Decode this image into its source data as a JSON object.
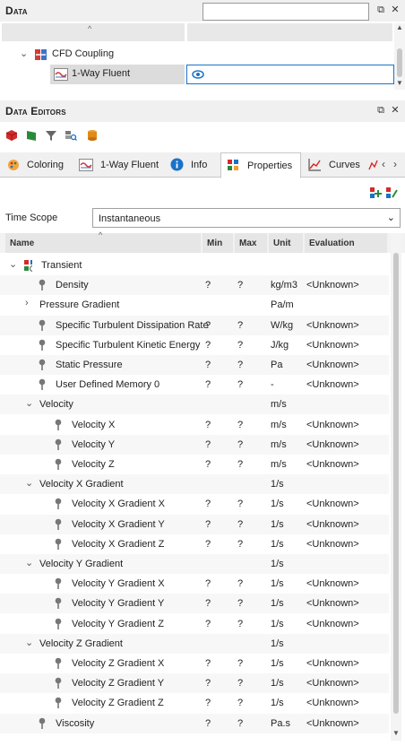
{
  "data_panel": {
    "title": "Data",
    "tree": {
      "root": {
        "label": "CFD Coupling"
      },
      "child": {
        "label": "1-Way Fluent"
      }
    }
  },
  "editors_panel": {
    "title": "Data Editors"
  },
  "tabs": [
    {
      "label": "Coloring",
      "icon": "palette-icon"
    },
    {
      "label": "1-Way Fluent",
      "icon": "fluent-icon"
    },
    {
      "label": "Info",
      "icon": "info-icon"
    },
    {
      "label": "Properties",
      "icon": "properties-icon",
      "active": true
    },
    {
      "label": "Curves",
      "icon": "curves-icon"
    }
  ],
  "time_scope": {
    "label": "Time Scope",
    "value": "Instantaneous"
  },
  "columns": {
    "name": "Name",
    "min": "Min",
    "max": "Max",
    "unit": "Unit",
    "evaluation": "Evaluation"
  },
  "rows": [
    {
      "name": "Transient",
      "level": 0,
      "kind": "group-root",
      "min": "",
      "max": "",
      "unit": "",
      "eval": ""
    },
    {
      "name": "Density",
      "level": 1,
      "kind": "prop",
      "min": "?",
      "max": "?",
      "unit": "kg/m3",
      "eval": "<Unknown>"
    },
    {
      "name": "Pressure Gradient",
      "level": 1,
      "kind": "collapsed",
      "min": "",
      "max": "",
      "unit": "Pa/m",
      "eval": ""
    },
    {
      "name": "Specific Turbulent Dissipation Rate",
      "level": 1,
      "kind": "prop",
      "min": "?",
      "max": "?",
      "unit": "W/kg",
      "eval": "<Unknown>"
    },
    {
      "name": "Specific Turbulent Kinetic Energy",
      "level": 1,
      "kind": "prop",
      "min": "?",
      "max": "?",
      "unit": "J/kg",
      "eval": "<Unknown>"
    },
    {
      "name": "Static Pressure",
      "level": 1,
      "kind": "prop",
      "min": "?",
      "max": "?",
      "unit": "Pa",
      "eval": "<Unknown>"
    },
    {
      "name": "User Defined Memory 0",
      "level": 1,
      "kind": "prop",
      "min": "?",
      "max": "?",
      "unit": "-",
      "eval": "<Unknown>"
    },
    {
      "name": "Velocity",
      "level": 1,
      "kind": "expanded",
      "min": "",
      "max": "",
      "unit": "m/s",
      "eval": ""
    },
    {
      "name": "Velocity X",
      "level": 2,
      "kind": "prop",
      "min": "?",
      "max": "?",
      "unit": "m/s",
      "eval": "<Unknown>"
    },
    {
      "name": "Velocity Y",
      "level": 2,
      "kind": "prop",
      "min": "?",
      "max": "?",
      "unit": "m/s",
      "eval": "<Unknown>"
    },
    {
      "name": "Velocity Z",
      "level": 2,
      "kind": "prop",
      "min": "?",
      "max": "?",
      "unit": "m/s",
      "eval": "<Unknown>"
    },
    {
      "name": "Velocity X Gradient",
      "level": 1,
      "kind": "expanded",
      "min": "",
      "max": "",
      "unit": "1/s",
      "eval": ""
    },
    {
      "name": "Velocity X Gradient X",
      "level": 2,
      "kind": "prop",
      "min": "?",
      "max": "?",
      "unit": "1/s",
      "eval": "<Unknown>"
    },
    {
      "name": "Velocity X Gradient Y",
      "level": 2,
      "kind": "prop",
      "min": "?",
      "max": "?",
      "unit": "1/s",
      "eval": "<Unknown>"
    },
    {
      "name": "Velocity X Gradient Z",
      "level": 2,
      "kind": "prop",
      "min": "?",
      "max": "?",
      "unit": "1/s",
      "eval": "<Unknown>"
    },
    {
      "name": "Velocity Y Gradient",
      "level": 1,
      "kind": "expanded",
      "min": "",
      "max": "",
      "unit": "1/s",
      "eval": ""
    },
    {
      "name": "Velocity Y Gradient X",
      "level": 2,
      "kind": "prop",
      "min": "?",
      "max": "?",
      "unit": "1/s",
      "eval": "<Unknown>"
    },
    {
      "name": "Velocity Y Gradient Y",
      "level": 2,
      "kind": "prop",
      "min": "?",
      "max": "?",
      "unit": "1/s",
      "eval": "<Unknown>"
    },
    {
      "name": "Velocity Y Gradient Z",
      "level": 2,
      "kind": "prop",
      "min": "?",
      "max": "?",
      "unit": "1/s",
      "eval": "<Unknown>"
    },
    {
      "name": "Velocity Z Gradient",
      "level": 1,
      "kind": "expanded",
      "min": "",
      "max": "",
      "unit": "1/s",
      "eval": ""
    },
    {
      "name": "Velocity Z Gradient X",
      "level": 2,
      "kind": "prop",
      "min": "?",
      "max": "?",
      "unit": "1/s",
      "eval": "<Unknown>"
    },
    {
      "name": "Velocity Z Gradient Y",
      "level": 2,
      "kind": "prop",
      "min": "?",
      "max": "?",
      "unit": "1/s",
      "eval": "<Unknown>"
    },
    {
      "name": "Velocity Z Gradient Z",
      "level": 2,
      "kind": "prop",
      "min": "?",
      "max": "?",
      "unit": "1/s",
      "eval": "<Unknown>"
    },
    {
      "name": "Viscosity",
      "level": 1,
      "kind": "prop",
      "min": "?",
      "max": "?",
      "unit": "Pa.s",
      "eval": "<Unknown>"
    }
  ],
  "colors": {
    "accent": "#1a73c8",
    "active_row": "#dcdcdc",
    "tab_border": "#c8c8c8"
  }
}
